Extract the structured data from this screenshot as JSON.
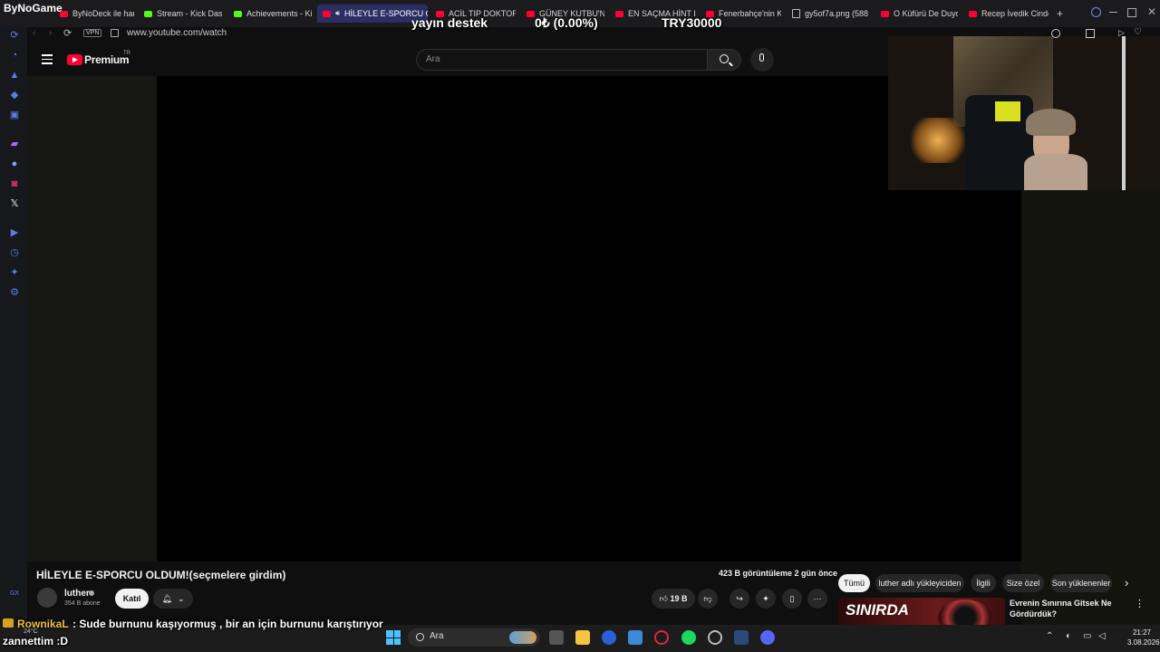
{
  "brand": "ByNoGame",
  "tabs": [
    {
      "label": "ByNoDeck ile harika",
      "fav": "yt"
    },
    {
      "label": "Stream - Kick Dash",
      "fav": "kick"
    },
    {
      "label": "Achievements - Ki",
      "fav": "kick"
    },
    {
      "label": "HİLEYLE E-SPORCU O",
      "fav": "yt",
      "active": true
    },
    {
      "label": "ACİL TIP DOKTORU",
      "fav": "yt"
    },
    {
      "label": "GÜNEY KUTBU'NU",
      "fav": "yt"
    },
    {
      "label": "EN SAÇMA HİNT D",
      "fav": "yt"
    },
    {
      "label": "Fenerbahçe'nin Ka",
      "fav": "yt"
    },
    {
      "label": "gy5of7a.png (588",
      "fav": "img"
    },
    {
      "label": "O Küfürü De Duydu",
      "fav": "yt"
    },
    {
      "label": "Recep İvedik Cinde",
      "fav": "yt"
    }
  ],
  "address": {
    "vpn": "VPN",
    "url": "www.youtube.com/watch"
  },
  "overlay": {
    "donation_label": "yayın destek",
    "donation_percent": "0₺ (0.00%)",
    "donation_goal": "TRY30000"
  },
  "youtube": {
    "logo_text": "Premium",
    "logo_sup": "TR",
    "search_placeholder": "Ara"
  },
  "video": {
    "title": "HİLEYLE E-SPORCU OLDUM!(seçmelere girdim)",
    "stats": "423 B görüntüleme  2 gün önce",
    "channel": "luther",
    "subscribers": "354 B abone",
    "join_label": "Katıl",
    "likes": "19 B"
  },
  "chips": [
    "Tümü",
    "luther adlı yükleyiciden",
    "İlgili",
    "Size özel",
    "Son yüklenenler"
  ],
  "recommendation": {
    "thumb_text": "SINIRDA",
    "title": "Evrenin Sınırına Gitsek Ne Gördürdük?"
  },
  "chat": {
    "user": "RownikaL",
    "message": ": Sude burnunu kaşıyormuş , bir an için burnunu karıştırıyor",
    "message2": "zannettim :D"
  },
  "taskbar": {
    "weather": "24°C",
    "search": "Ara",
    "time": "21:27",
    "date": "3.08.2026"
  },
  "colors": {
    "youtube_red": "#ff0033",
    "active_tab": "#2a2e63",
    "sidebar_icons": "#5d7de6"
  }
}
